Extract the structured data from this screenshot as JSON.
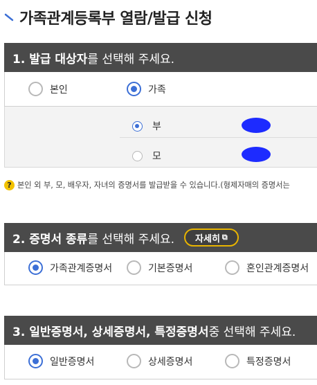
{
  "page": {
    "title": "가족관계등록부 열람/발급 신청"
  },
  "section1": {
    "head_bold": "1. 발급 대상자",
    "head_rest": "를 선택해 주세요.",
    "options": [
      {
        "label": "본인",
        "selected": false
      },
      {
        "label": "가족",
        "selected": true
      }
    ],
    "family": [
      {
        "label": "부",
        "selected": true
      },
      {
        "label": "모",
        "selected": false
      }
    ],
    "notice": "본인 외 부, 모, 배우자, 자녀의 증명서를 발급받을 수 있습니다.(형제자매의 증명서는"
  },
  "section2": {
    "head_bold1": "2. 증명서 종류",
    "head_rest": "를 선택해 주세요.",
    "detail_button": "자세히",
    "options": [
      {
        "label": "가족관계증명서",
        "selected": true
      },
      {
        "label": "기본증명서",
        "selected": false
      },
      {
        "label": "혼인관계증명서",
        "selected": false
      }
    ]
  },
  "section3": {
    "head_bold": "3. 일반증명서, 상세증명서, 특정증명서",
    "head_rest": " 중 선택해 주세요.",
    "options": [
      {
        "label": "일반증명서",
        "selected": true
      },
      {
        "label": "상세증명서",
        "selected": false
      },
      {
        "label": "특정증명서",
        "selected": false
      }
    ]
  },
  "colors": {
    "accent": "#3c6fd6",
    "header_bg": "#4a4a4a",
    "detail_border": "#e8b400",
    "redaction": "#1d2bff"
  }
}
